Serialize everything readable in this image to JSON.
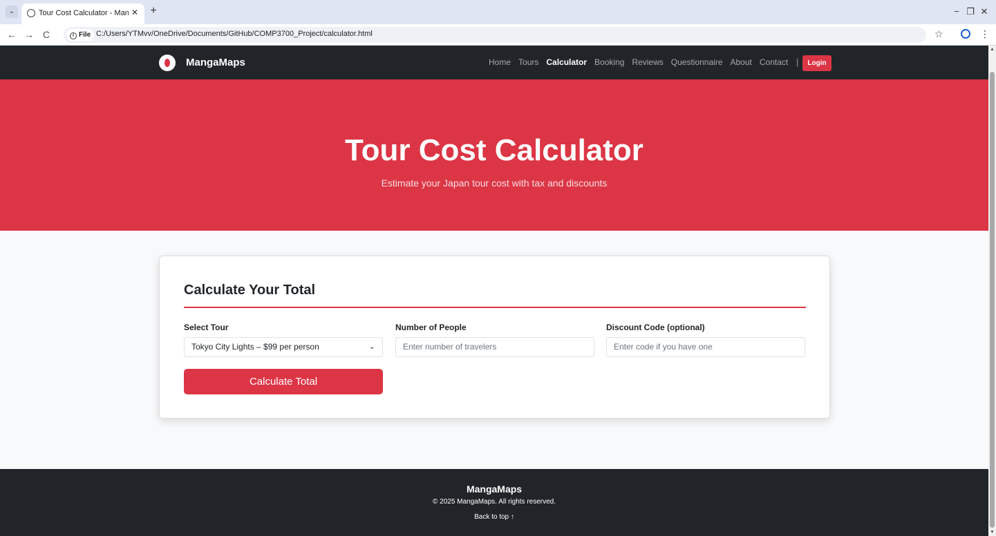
{
  "browser": {
    "tab_title": "Tour Cost Calculator - MangaM",
    "tab_close": "✕",
    "new_tab": "+",
    "url_chip": "File",
    "url": "C:/Users/YTMvv/OneDrive/Documents/GitHub/COMP3700_Project/calculator.html",
    "icons": {
      "back": "←",
      "forward": "→",
      "reload": "C",
      "star": "☆",
      "menu": "⋮",
      "minimize": "−",
      "restore": "❐",
      "close": "✕",
      "tab_menu": "⌄"
    }
  },
  "nav": {
    "brand": "MangaMaps",
    "links": [
      "Home",
      "Tours",
      "Calculator",
      "Booking",
      "Reviews",
      "Questionnaire",
      "About",
      "Contact"
    ],
    "active": "Calculator",
    "separator": "|",
    "login": "Login"
  },
  "hero": {
    "title": "Tour Cost Calculator",
    "subtitle": "Estimate your Japan tour cost with tax and discounts"
  },
  "calculator": {
    "title": "Calculate Your Total",
    "tour_label": "Select Tour",
    "tour_value": "Tokyo City Lights – $99 per person",
    "people_label": "Number of People",
    "people_placeholder": "Enter number of travelers",
    "discount_label": "Discount Code (optional)",
    "discount_placeholder": "Enter code if you have one",
    "button": "Calculate Total"
  },
  "footer": {
    "brand": "MangaMaps",
    "copyright": "© 2025 MangaMaps. All rights reserved.",
    "back_to_top": "Back to top ↑"
  },
  "colors": {
    "accent": "#dc3545",
    "dark": "#212529",
    "page_bg": "#f8f9fa"
  }
}
